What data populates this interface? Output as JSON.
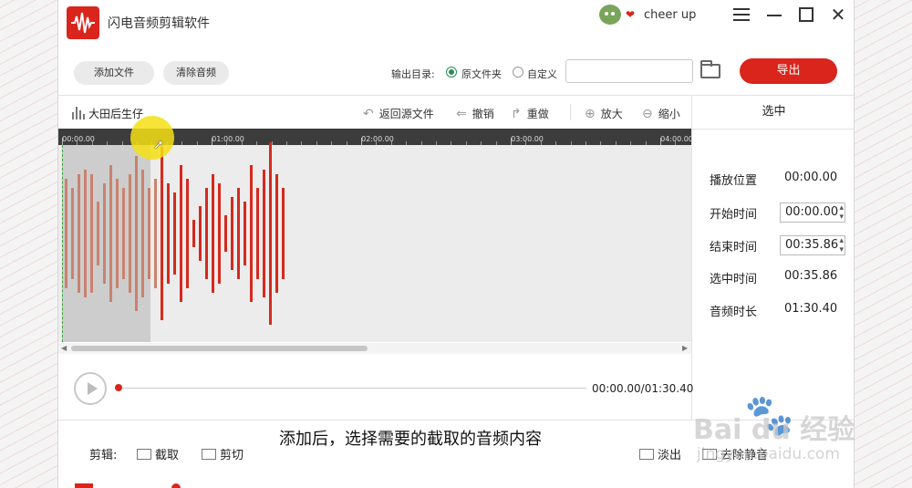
{
  "app": {
    "title": "闪电音频剪辑软件",
    "user": "cheer up"
  },
  "toolbar": {
    "add_file": "添加文件",
    "clear_audio": "清除音频",
    "output_label": "输出目录:",
    "radio_source": "原文件夹",
    "radio_custom": "自定义",
    "path_value": "",
    "export": "导出"
  },
  "editor": {
    "track_name": "大田后生仔",
    "revert": "返回源文件",
    "undo": "撤销",
    "redo": "重做",
    "zoom_in": "放大",
    "zoom_out": "缩小",
    "ruler_labels": [
      "00:00.00",
      "01:00.00",
      "02:00.00",
      "03:00.00",
      "04:00.00"
    ]
  },
  "waveform": {
    "selected_color": "#c9826e",
    "unselected_color": "#d42a1e",
    "bars": [
      120,
      100,
      130,
      140,
      130,
      70,
      110,
      150,
      120,
      100,
      130,
      170,
      140,
      100,
      120,
      190,
      110,
      90,
      150,
      120,
      30,
      60,
      100,
      130,
      110,
      40,
      80,
      100,
      70,
      150,
      100,
      140,
      200,
      130,
      100
    ],
    "selected_count": 15
  },
  "selection_panel": {
    "header": "选中",
    "play_position_label": "播放位置",
    "play_position": "00:00.00",
    "start_label": "开始时间",
    "start": "00:00.00",
    "end_label": "结束时间",
    "end": "00:35.86",
    "selected_label": "选中时间",
    "selected": "00:35.86",
    "duration_label": "音频时长",
    "duration": "01:30.40"
  },
  "playback": {
    "time": "00:00.00/01:30.40",
    "progress": 0
  },
  "edit_tools": {
    "label": "剪辑:",
    "cut_out": "截取",
    "cut": "剪切",
    "fade_out": "淡出",
    "remove_silence": "去除静音"
  },
  "caption": "添加后，选择需要的截取的音频内容",
  "watermark": {
    "brand": "Bai du 经验",
    "url": "jingyan.baidu.com"
  }
}
